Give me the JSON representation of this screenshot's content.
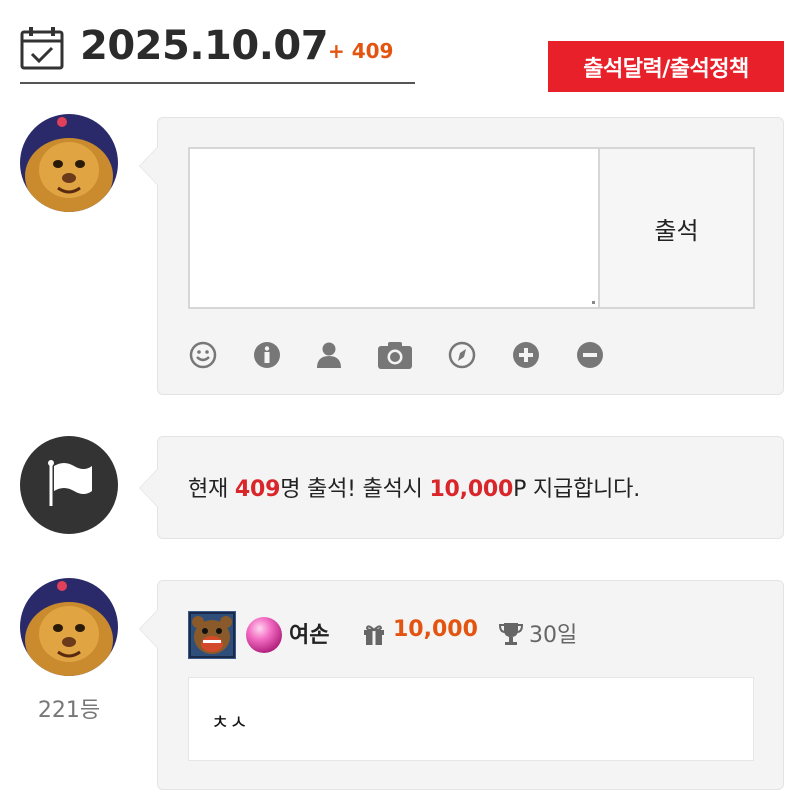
{
  "header": {
    "date": "2025.10.07",
    "today_count": "+ 409",
    "policy_button": "출석달력/출석정책"
  },
  "form": {
    "memo_value": "",
    "submit_label": "출석",
    "toolbar_icons": [
      "smile-icon",
      "info-icon",
      "user-icon",
      "camera-icon",
      "compass-icon",
      "plus-circle-icon",
      "minus-circle-icon"
    ]
  },
  "notice": {
    "prefix": "현재 ",
    "count": "409",
    "middle": "명 출석! 출석시 ",
    "points": "10,000",
    "suffix": "P 지급합니다."
  },
  "entries": [
    {
      "nickname": "여손",
      "points": "10,000",
      "days": "30일",
      "comment": "ㅊㅅ",
      "rank": "221등"
    }
  ],
  "colors": {
    "accent_red": "#e8202a",
    "highlight_red": "#d9262b",
    "points_orange": "#e2540f",
    "card_bg": "#f4f4f4"
  }
}
